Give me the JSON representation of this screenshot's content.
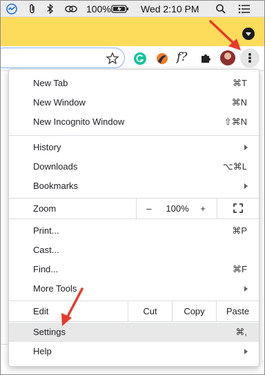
{
  "menubar": {
    "battery_percent": "100%",
    "clock": "Wed 2:10 PM",
    "icons": [
      "activity-icon",
      "paperclip-icon",
      "bluetooth-icon",
      "cloud-sync-icon",
      "battery-charging-icon",
      "search-icon",
      "control-center-icon"
    ]
  },
  "toolbar": {
    "icons": [
      "star-icon",
      "grammarly-icon",
      "extension-icon",
      "formula-icon",
      "puzzle-icon",
      "avatar",
      "more-menu-icon"
    ],
    "formula_glyph": "f?"
  },
  "menu": {
    "group1": [
      {
        "label": "New Tab",
        "shortcut": "⌘T"
      },
      {
        "label": "New Window",
        "shortcut": "⌘N"
      },
      {
        "label": "New Incognito Window",
        "shortcut": "⇧⌘N"
      }
    ],
    "group2": [
      {
        "label": "History",
        "submenu": true
      },
      {
        "label": "Downloads",
        "shortcut": "⌥⌘L"
      },
      {
        "label": "Bookmarks",
        "submenu": true
      }
    ],
    "zoom": {
      "label": "Zoom",
      "minus": "–",
      "value": "100%",
      "plus": "+"
    },
    "group3": [
      {
        "label": "Print...",
        "shortcut": "⌘P"
      },
      {
        "label": "Cast..."
      },
      {
        "label": "Find...",
        "shortcut": "⌘F"
      },
      {
        "label": "More Tools",
        "submenu": true
      }
    ],
    "edit": {
      "label": "Edit",
      "cut": "Cut",
      "copy": "Copy",
      "paste": "Paste"
    },
    "group4": [
      {
        "label": "Settings",
        "shortcut": "⌘,",
        "highlighted": true
      },
      {
        "label": "Help",
        "submenu": true
      }
    ]
  },
  "colors": {
    "tabstrip": "#fddc5c",
    "omnibox_border": "#8ab4f8",
    "highlight": "#e8e8e8",
    "annotation_arrow": "#e8392b"
  }
}
